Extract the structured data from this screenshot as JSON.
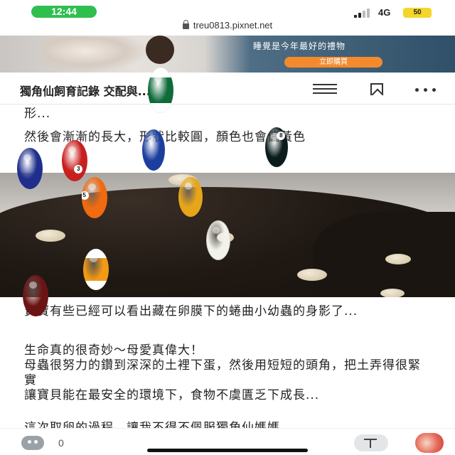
{
  "status_bar": {
    "time": "12:44",
    "network": "4G",
    "battery": "50"
  },
  "browser": {
    "url": "treu0813.pixnet.net"
  },
  "ad": {
    "slogan": "睡覺是今年最好的禮物",
    "cta": "立即購買"
  },
  "header": {
    "title": "獨角仙飼育記錄  交配與..."
  },
  "article": {
    "line_top": "形...",
    "para1": "然後會漸漸的長大，形狀比較圓，顏色也會偏黃色",
    "para2": "寶寶有些已經可以看出藏在卵膜下的蜷曲小幼蟲的身影了...",
    "para3_line1": "生命真的很奇妙～母愛真偉大！",
    "para3_line2": "母蟲很努力的鑽到深深的土裡下蛋，然後用短短的頭角，把土弄得很緊實",
    "para3_line3": "讓寶貝能在最安全的環境下，食物不虞匱乏下成長...",
    "para4": "這次取卵的過程，讓我不得不佩服獨角仙媽媽"
  },
  "balls": [
    {
      "number": "",
      "color": "#0f6b3a",
      "stripe": true
    },
    {
      "number": "",
      "color": "#1c3f9e",
      "stripe": false
    },
    {
      "number": "8",
      "color": "#0c1c1c",
      "stripe": false
    },
    {
      "number": "3",
      "color": "#c8201f",
      "stripe": false
    },
    {
      "number": "",
      "color": "#1f2e8c",
      "stripe": false
    },
    {
      "number": "",
      "color": "#e7a61a",
      "stripe": false
    },
    {
      "number": "5",
      "color": "#f06a10",
      "stripe": false
    },
    {
      "number": "",
      "color": "#f2f2ea",
      "stripe": false
    },
    {
      "number": "",
      "color": "#f39a14",
      "stripe": true
    },
    {
      "number": "",
      "color": "#6b1414",
      "stripe": false
    }
  ],
  "bottom_bar": {
    "like_count": "0"
  },
  "icons": [
    "lock-icon",
    "menu-icon",
    "bookmark-icon",
    "more-icon",
    "like-icon",
    "font-size-icon",
    "avatar"
  ],
  "colors": {
    "status_time_green": "#2fbf4f",
    "ad_cta_orange": "#f58a2c",
    "battery_yellow": "#f3d62a"
  }
}
